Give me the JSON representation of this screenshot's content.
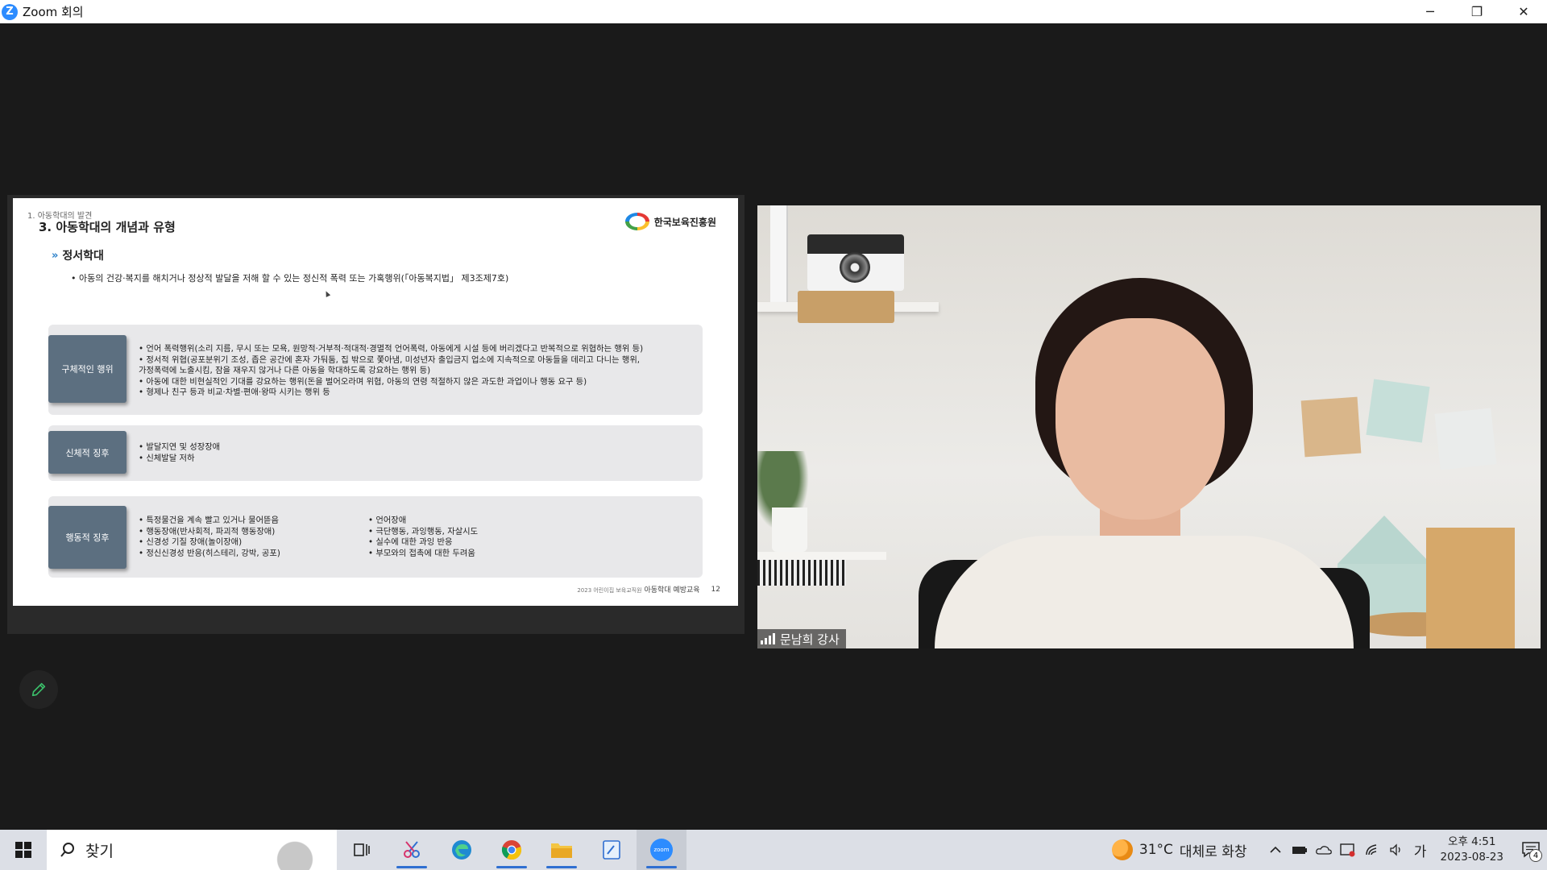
{
  "window": {
    "title": "Zoom 회의",
    "logo_letter": "Z",
    "controls": {
      "minimize": "─",
      "restore": "❐",
      "close": "✕"
    }
  },
  "slide": {
    "section": "1. 아동학대의 발견",
    "title": "3. 아동학대의 개념과 유형",
    "org_name": "한국보육진흥원",
    "subtitle_marker": "»",
    "subtitle": "정서학대",
    "definition": "• 아동의 건강·복지를 해치거나 정상적 발달을 저해 할 수 있는 정신적 폭력 또는 가혹행위(「아동복지법」 제3조제7호)",
    "boxes": [
      {
        "label": "구체적인 행위",
        "lines": [
          "• 언어 폭력행위(소리 지름, 무시 또는 모욕, 원망적·거부적·적대적·경멸적 언어폭력, 아동에게 시설 등에 버리겠다고 반복적으로 위협하는 행위 등)",
          "• 정서적 위협(공포분위기 조성, 좁은 공간에 혼자 가둬둠, 집 밖으로 쫓아냄, 미성년자 출입금지 업소에 지속적으로 아동들을 데리고 다니는 행위,",
          "   가정폭력에 노출시킴, 잠을 재우지 않거나 다른 아동을 학대하도록 강요하는 행위 등)",
          "• 아동에 대한 비현실적인 기대를 강요하는 행위(돈을 벌어오라며 위협, 아동의 연령 적절하지 않은 과도한 과업이나 행동 요구 등)",
          "• 형제나 친구 등과 비교·차별·편애·왕따 시키는 행위 등"
        ]
      },
      {
        "label": "신체적 징후",
        "lines": [
          "• 발달지연 및 성장장애",
          "• 신체발달 저하"
        ]
      },
      {
        "label": "행동적 징후",
        "col1": [
          "• 특정물건을 계속 빨고 있거나 물어뜯음",
          "• 행동장애(반사회적, 파괴적 행동장애)",
          "• 신경성 기질 장애(놀이장애)",
          "• 정신신경성 반응(히스테리, 강박, 공포)"
        ],
        "col2": [
          "• 언어장애",
          "• 극단행동, 과잉행동, 자살시도",
          "• 실수에 대한 과잉 반응",
          "• 부모와의 접촉에 대한 두려움"
        ]
      }
    ],
    "footer_small": "2023 어린이집 보육교직원",
    "footer_course": "아동학대 예방교육",
    "page_number": "12"
  },
  "video": {
    "participant_name": "문남희 강사"
  },
  "taskbar": {
    "search_label": "찾기",
    "zoom_label": "zoom",
    "weather_temp": "31°C",
    "weather_desc": "대체로 화창",
    "ime": "가",
    "time": "오후 4:51",
    "date": "2023-08-23",
    "notification_count": "4"
  },
  "colors": {
    "slide_label_bg": "#5c6f80",
    "slide_box_bg": "#e8e8ea",
    "zoom_blue": "#2d8cff",
    "taskbar_bg": "#dcdfe6",
    "meeting_bg": "#1a1a1a"
  },
  "icons": [
    "zoom-logo-icon",
    "minimize-icon",
    "restore-icon",
    "close-icon",
    "windows-start-icon",
    "search-icon",
    "task-view-icon",
    "snipping-tool-icon",
    "edge-icon",
    "chrome-icon",
    "file-explorer-icon",
    "notepad-icon",
    "zoom-icon",
    "weather-icon",
    "chevron-up-icon",
    "battery-icon",
    "onedrive-icon",
    "security-icon",
    "wifi-icon",
    "volume-icon",
    "notification-icon",
    "pencil-icon",
    "signal-bars-icon"
  ]
}
